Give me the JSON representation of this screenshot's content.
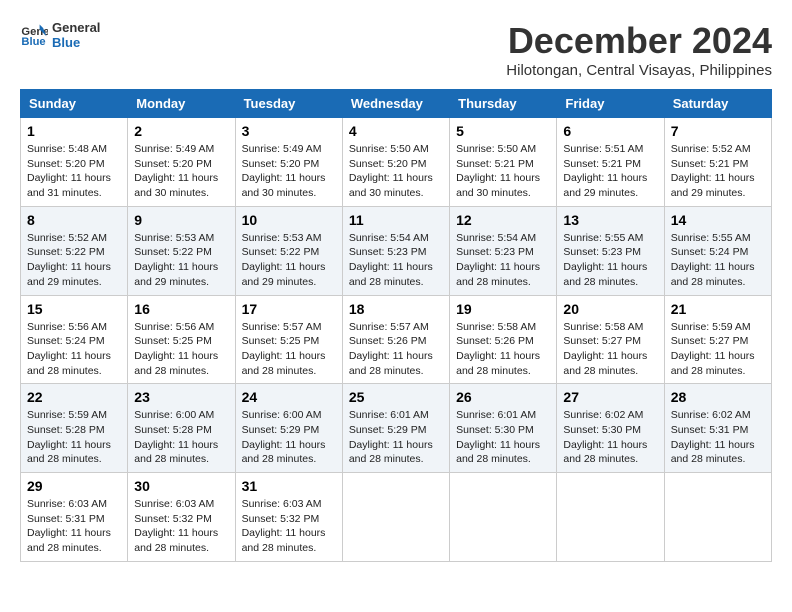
{
  "logo": {
    "line1": "General",
    "line2": "Blue"
  },
  "title": "December 2024",
  "location": "Hilotongan, Central Visayas, Philippines",
  "days_of_week": [
    "Sunday",
    "Monday",
    "Tuesday",
    "Wednesday",
    "Thursday",
    "Friday",
    "Saturday"
  ],
  "weeks": [
    [
      {
        "day": "1",
        "sunrise": "5:48 AM",
        "sunset": "5:20 PM",
        "daylight": "11 hours and 31 minutes."
      },
      {
        "day": "2",
        "sunrise": "5:49 AM",
        "sunset": "5:20 PM",
        "daylight": "11 hours and 30 minutes."
      },
      {
        "day": "3",
        "sunrise": "5:49 AM",
        "sunset": "5:20 PM",
        "daylight": "11 hours and 30 minutes."
      },
      {
        "day": "4",
        "sunrise": "5:50 AM",
        "sunset": "5:20 PM",
        "daylight": "11 hours and 30 minutes."
      },
      {
        "day": "5",
        "sunrise": "5:50 AM",
        "sunset": "5:21 PM",
        "daylight": "11 hours and 30 minutes."
      },
      {
        "day": "6",
        "sunrise": "5:51 AM",
        "sunset": "5:21 PM",
        "daylight": "11 hours and 29 minutes."
      },
      {
        "day": "7",
        "sunrise": "5:52 AM",
        "sunset": "5:21 PM",
        "daylight": "11 hours and 29 minutes."
      }
    ],
    [
      {
        "day": "8",
        "sunrise": "5:52 AM",
        "sunset": "5:22 PM",
        "daylight": "11 hours and 29 minutes."
      },
      {
        "day": "9",
        "sunrise": "5:53 AM",
        "sunset": "5:22 PM",
        "daylight": "11 hours and 29 minutes."
      },
      {
        "day": "10",
        "sunrise": "5:53 AM",
        "sunset": "5:22 PM",
        "daylight": "11 hours and 29 minutes."
      },
      {
        "day": "11",
        "sunrise": "5:54 AM",
        "sunset": "5:23 PM",
        "daylight": "11 hours and 28 minutes."
      },
      {
        "day": "12",
        "sunrise": "5:54 AM",
        "sunset": "5:23 PM",
        "daylight": "11 hours and 28 minutes."
      },
      {
        "day": "13",
        "sunrise": "5:55 AM",
        "sunset": "5:23 PM",
        "daylight": "11 hours and 28 minutes."
      },
      {
        "day": "14",
        "sunrise": "5:55 AM",
        "sunset": "5:24 PM",
        "daylight": "11 hours and 28 minutes."
      }
    ],
    [
      {
        "day": "15",
        "sunrise": "5:56 AM",
        "sunset": "5:24 PM",
        "daylight": "11 hours and 28 minutes."
      },
      {
        "day": "16",
        "sunrise": "5:56 AM",
        "sunset": "5:25 PM",
        "daylight": "11 hours and 28 minutes."
      },
      {
        "day": "17",
        "sunrise": "5:57 AM",
        "sunset": "5:25 PM",
        "daylight": "11 hours and 28 minutes."
      },
      {
        "day": "18",
        "sunrise": "5:57 AM",
        "sunset": "5:26 PM",
        "daylight": "11 hours and 28 minutes."
      },
      {
        "day": "19",
        "sunrise": "5:58 AM",
        "sunset": "5:26 PM",
        "daylight": "11 hours and 28 minutes."
      },
      {
        "day": "20",
        "sunrise": "5:58 AM",
        "sunset": "5:27 PM",
        "daylight": "11 hours and 28 minutes."
      },
      {
        "day": "21",
        "sunrise": "5:59 AM",
        "sunset": "5:27 PM",
        "daylight": "11 hours and 28 minutes."
      }
    ],
    [
      {
        "day": "22",
        "sunrise": "5:59 AM",
        "sunset": "5:28 PM",
        "daylight": "11 hours and 28 minutes."
      },
      {
        "day": "23",
        "sunrise": "6:00 AM",
        "sunset": "5:28 PM",
        "daylight": "11 hours and 28 minutes."
      },
      {
        "day": "24",
        "sunrise": "6:00 AM",
        "sunset": "5:29 PM",
        "daylight": "11 hours and 28 minutes."
      },
      {
        "day": "25",
        "sunrise": "6:01 AM",
        "sunset": "5:29 PM",
        "daylight": "11 hours and 28 minutes."
      },
      {
        "day": "26",
        "sunrise": "6:01 AM",
        "sunset": "5:30 PM",
        "daylight": "11 hours and 28 minutes."
      },
      {
        "day": "27",
        "sunrise": "6:02 AM",
        "sunset": "5:30 PM",
        "daylight": "11 hours and 28 minutes."
      },
      {
        "day": "28",
        "sunrise": "6:02 AM",
        "sunset": "5:31 PM",
        "daylight": "11 hours and 28 minutes."
      }
    ],
    [
      {
        "day": "29",
        "sunrise": "6:03 AM",
        "sunset": "5:31 PM",
        "daylight": "11 hours and 28 minutes."
      },
      {
        "day": "30",
        "sunrise": "6:03 AM",
        "sunset": "5:32 PM",
        "daylight": "11 hours and 28 minutes."
      },
      {
        "day": "31",
        "sunrise": "6:03 AM",
        "sunset": "5:32 PM",
        "daylight": "11 hours and 28 minutes."
      },
      null,
      null,
      null,
      null
    ]
  ]
}
